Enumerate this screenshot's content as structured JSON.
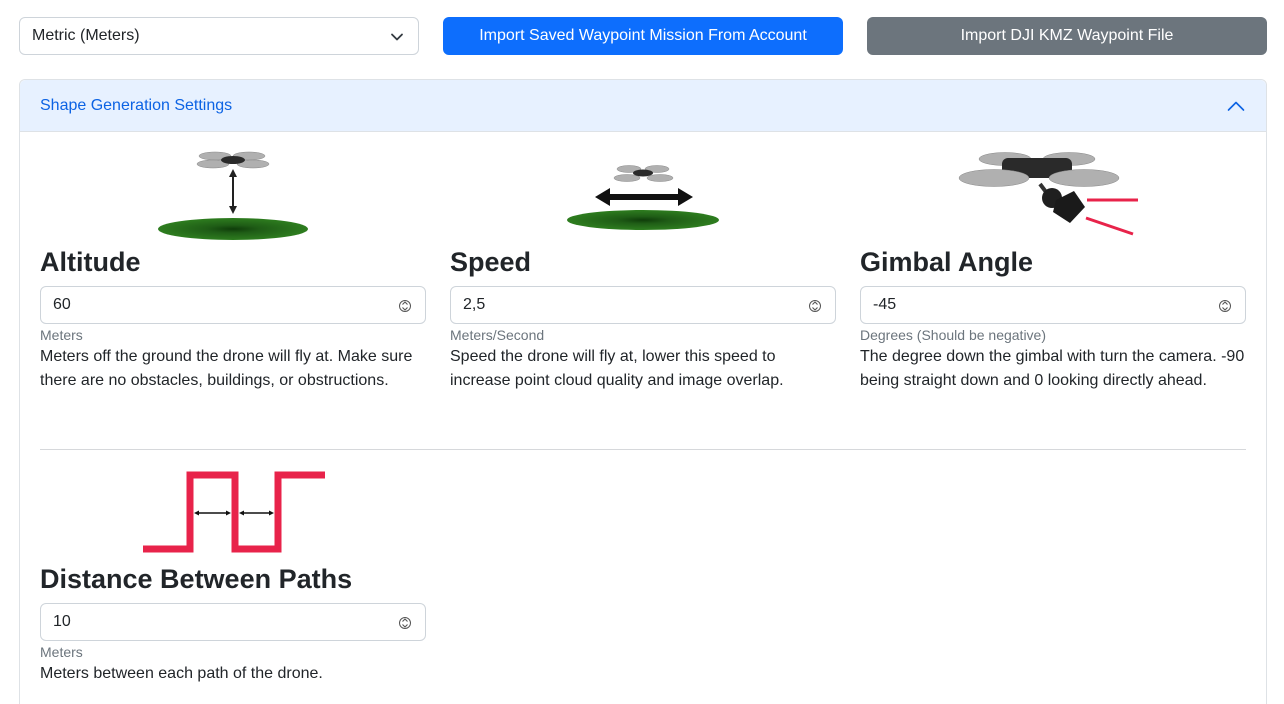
{
  "toolbar": {
    "units_value": "Metric (Meters)",
    "import_account_label": "Import Saved Waypoint Mission From Account",
    "import_kmz_label": "Import DJI KMZ Waypoint File"
  },
  "panel": {
    "header": "Shape Generation Settings"
  },
  "fields": {
    "altitude": {
      "label": "Altitude",
      "value": "60",
      "unit": "Meters",
      "description": "Meters off the ground the drone will fly at. Make sure there are no obstacles, buildings, or obstructions."
    },
    "speed": {
      "label": "Speed",
      "value": "2,5",
      "unit": "Meters/Second",
      "description": "Speed the drone will fly at, lower this speed to increase point cloud quality and image overlap."
    },
    "gimbal": {
      "label": "Gimbal Angle",
      "value": "-45",
      "unit": "Degrees (Should be negative)",
      "description": "The degree down the gimbal with turn the camera. -90 being straight down and 0 looking directly ahead."
    },
    "distance": {
      "label": "Distance Between Paths",
      "value": "10",
      "unit": "Meters",
      "description": "Meters between each path of the drone."
    }
  },
  "colors": {
    "primary": "#0d6efd",
    "secondary": "#6c757d",
    "header_bg": "#e7f1ff",
    "header_text": "#0c63e4",
    "ground_green": "#2e7d1f",
    "path_red": "#e8234a"
  }
}
